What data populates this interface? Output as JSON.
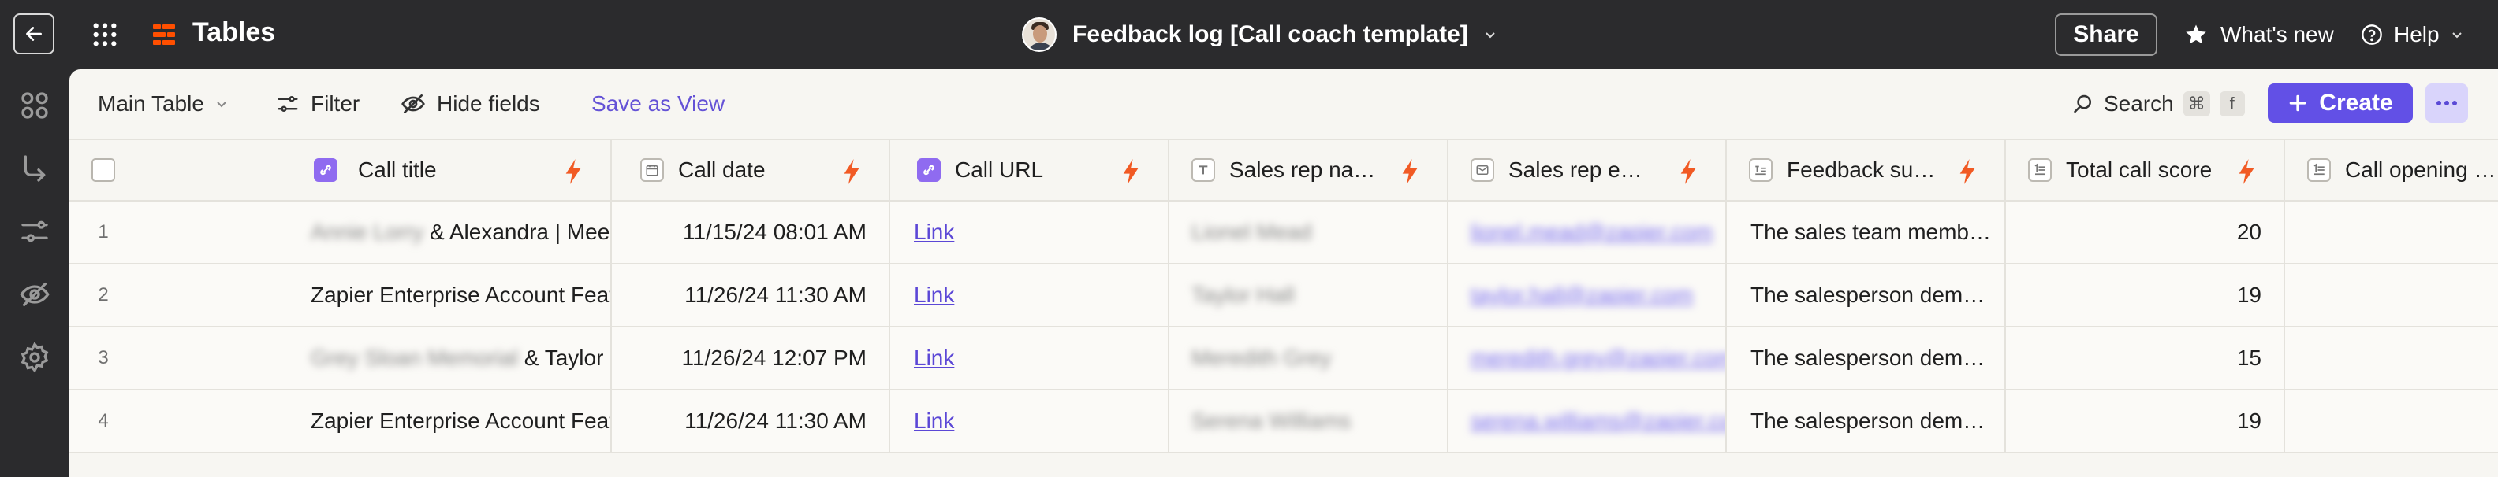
{
  "app": {
    "title": "Tables"
  },
  "document": {
    "title": "Feedback log [Call coach template]"
  },
  "header": {
    "share": "Share",
    "whats_new": "What's new",
    "help": "Help"
  },
  "toolbar": {
    "view": "Main Table",
    "filter": "Filter",
    "hide_fields": "Hide fields",
    "save_view": "Save as View",
    "search": "Search",
    "kbd_cmd": "⌘",
    "kbd_key": "f",
    "create": "Create"
  },
  "columns": [
    {
      "label": "Call title",
      "icon": "link-record-icon"
    },
    {
      "label": "Call date",
      "icon": "calendar-icon"
    },
    {
      "label": "Call URL",
      "icon": "link-record-icon"
    },
    {
      "label": "Sales rep na…",
      "icon": "text-icon"
    },
    {
      "label": "Sales rep e…",
      "icon": "email-icon"
    },
    {
      "label": "Feedback su…",
      "icon": "long-text-icon"
    },
    {
      "label": "Total call score",
      "icon": "number-icon"
    },
    {
      "label": "Call opening …",
      "icon": "number-icon"
    }
  ],
  "rows": [
    {
      "num": "1",
      "title_blur": "Annie Lorry",
      "title": " & Alexandra | Meeting",
      "date": "11/15/24 08:01 AM",
      "url": "Link",
      "rep_name": "Lionel Mead",
      "rep_email": "lionel.mead@zapier.com",
      "feedback": "The sales team memb…",
      "score": "20"
    },
    {
      "num": "2",
      "title_blur": "",
      "title": "Zapier Enterprise Account Featur…",
      "date": "11/26/24 11:30 AM",
      "url": "Link",
      "rep_name": "Taylor Hall",
      "rep_email": "taylor.hall@zapier.com",
      "feedback": "The salesperson dem…",
      "score": "19"
    },
    {
      "num": "3",
      "title_blur": "Grey Sloan Memorial",
      "title": " & Taylor | M…",
      "date": "11/26/24 12:07 PM",
      "url": "Link",
      "rep_name": "Meredith Grey",
      "rep_email": "meredith.grey@zapier.com",
      "feedback": "The salesperson dem…",
      "score": "15"
    },
    {
      "num": "4",
      "title_blur": "",
      "title": "Zapier Enterprise Account Featur…",
      "date": "11/26/24 11:30 AM",
      "url": "Link",
      "rep_name": "Serena Williams",
      "rep_email": "serena.williams@zapier.com",
      "feedback": "The salesperson dem…",
      "score": "19"
    }
  ],
  "colors": {
    "accent": "#6250e6",
    "bolt": "#f15a24",
    "brand": "#ff4f00"
  }
}
